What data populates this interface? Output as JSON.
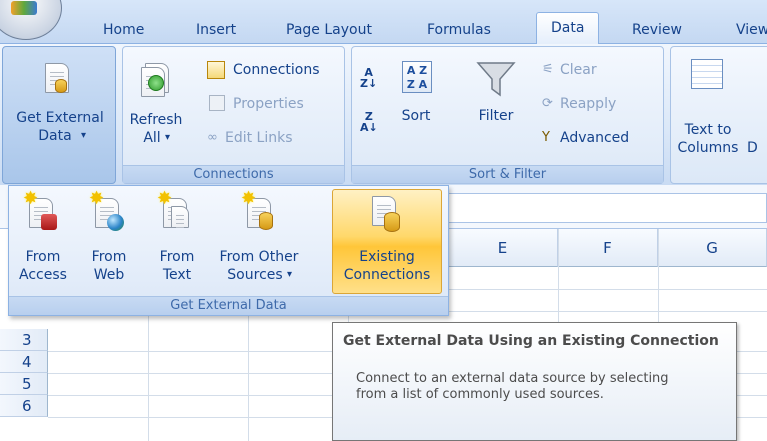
{
  "tabs": [
    {
      "label": "Home"
    },
    {
      "label": "Insert"
    },
    {
      "label": "Page Layout"
    },
    {
      "label": "Formulas"
    },
    {
      "label": "Data",
      "active": true
    },
    {
      "label": "Review"
    },
    {
      "label": "View"
    }
  ],
  "ribbon": {
    "get_external_data": {
      "label_line1": "Get External",
      "label_line2": "Data"
    },
    "connections_group": {
      "label": "Connections",
      "refresh": {
        "label_line1": "Refresh",
        "label_line2": "All"
      },
      "connections": "Connections",
      "properties": "Properties",
      "edit_links": "Edit Links"
    },
    "sort_filter_group": {
      "label": "Sort & Filter",
      "sort": "Sort",
      "filter": "Filter",
      "clear": "Clear",
      "reapply": "Reapply",
      "advanced": "Advanced"
    },
    "data_tools": {
      "text_to_columns_line1": "Text to",
      "text_to_columns_line2": "Columns"
    }
  },
  "dropdown": {
    "group_label": "Get External Data",
    "from_access": {
      "line1": "From",
      "line2": "Access"
    },
    "from_web": {
      "line1": "From",
      "line2": "Web"
    },
    "from_text": {
      "line1": "From",
      "line2": "Text"
    },
    "from_other": {
      "line1": "From Other",
      "line2": "Sources"
    },
    "existing": {
      "line1": "Existing",
      "line2": "Connections"
    }
  },
  "sheet": {
    "columns": [
      "E",
      "F",
      "G"
    ],
    "rows": [
      "3",
      "4",
      "5",
      "6"
    ]
  },
  "tooltip": {
    "title": "Get External Data Using an Existing Connection",
    "body": "Connect to an external data source by selecting from a list of commonly used sources."
  },
  "colors": {
    "accent": "#15428b",
    "ribbon_bg": "#dbe8f8",
    "highlight": "#ffd86b"
  }
}
